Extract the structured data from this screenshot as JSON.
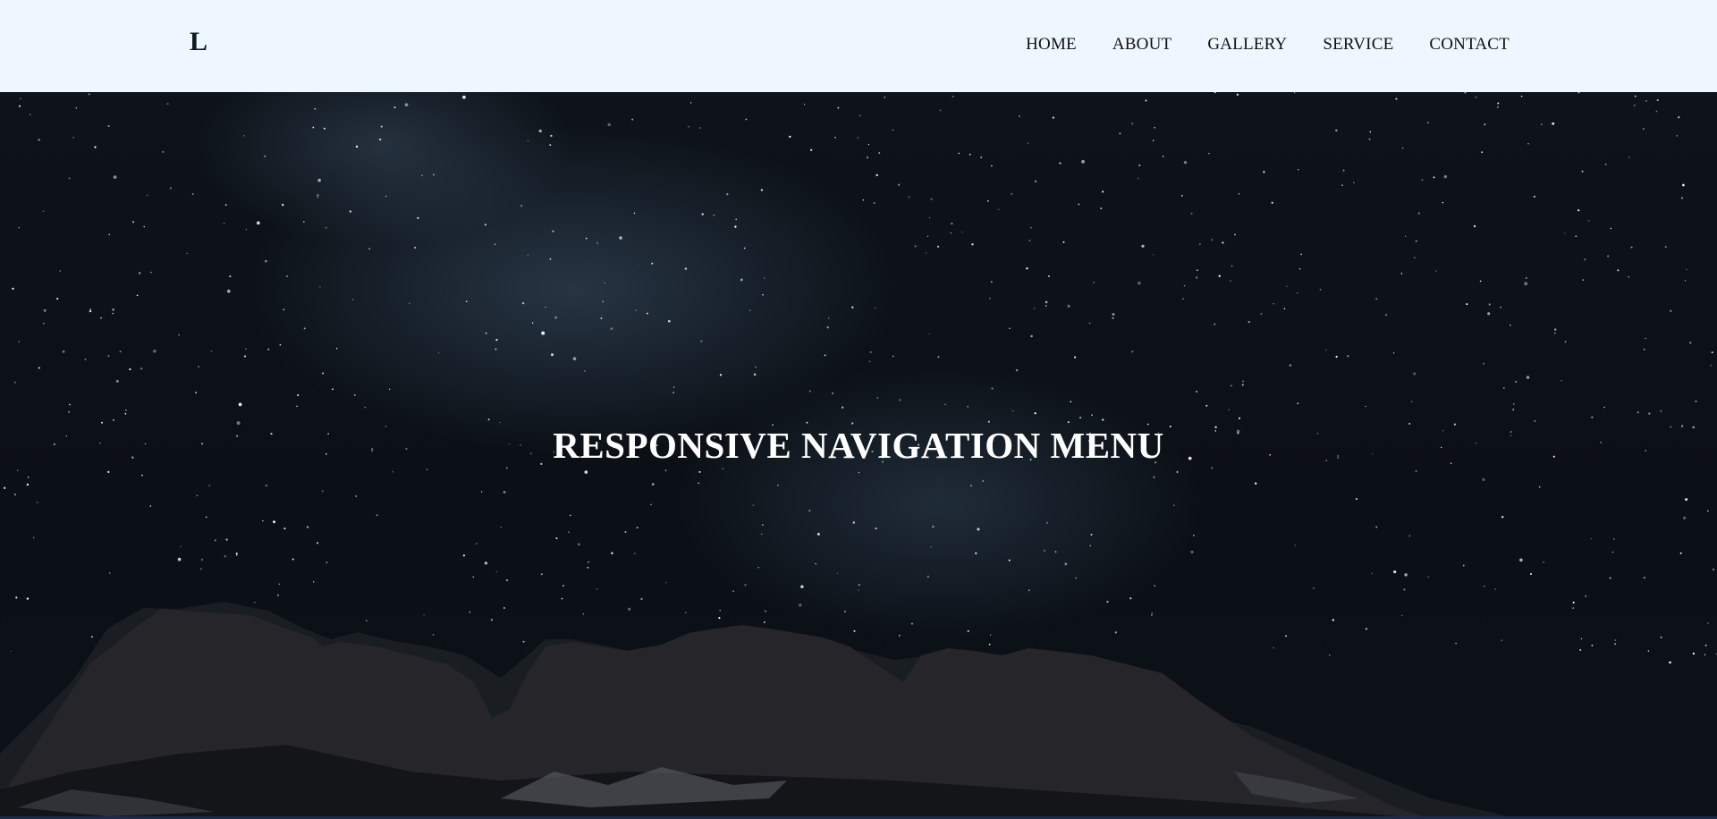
{
  "navbar": {
    "logo": "L",
    "links": [
      {
        "label": "HOME"
      },
      {
        "label": "ABOUT"
      },
      {
        "label": "GALLERY"
      },
      {
        "label": "SERVICE"
      },
      {
        "label": "CONTACT"
      }
    ],
    "background_color": "#eef7ff"
  },
  "hero": {
    "title": "RESPONSIVE NAVIGATION MENU",
    "background_description_icon": "starry-night-mountains-image"
  }
}
